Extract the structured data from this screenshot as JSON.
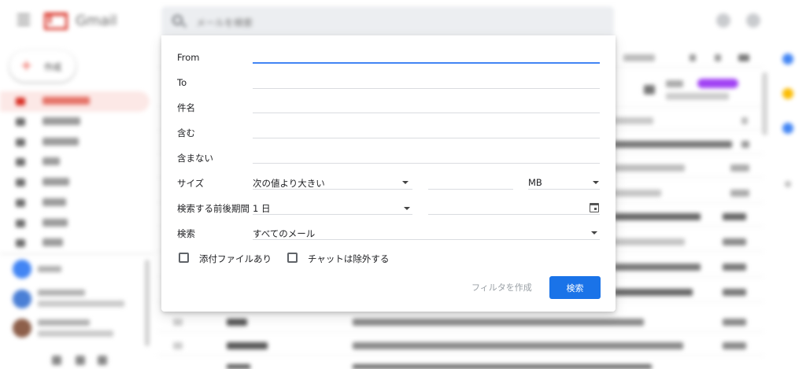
{
  "background": {
    "app_name": "Gmail",
    "search_placeholder": "メールを検索",
    "compose_label": "作成"
  },
  "search_panel": {
    "fields": {
      "from_label": "From",
      "to_label": "To",
      "subject_label": "件名",
      "has_words_label": "含む",
      "doesnt_have_label": "含まない",
      "size_label": "サイズ",
      "date_within_label": "検索する前後期間",
      "search_in_label": "検索"
    },
    "size_operator": "次の値より大きい",
    "size_unit": "MB",
    "date_within_value": "1 日",
    "search_in_value": "すべてのメール",
    "has_attachment_label": "添付ファイルあり",
    "exclude_chats_label": "チャットは除外する",
    "create_filter_label": "フィルタを作成",
    "search_button_label": "検索"
  },
  "colors": {
    "accent": "#1a73e8",
    "focus_underline": "#4285f4",
    "gmail_red": "#d93025"
  }
}
